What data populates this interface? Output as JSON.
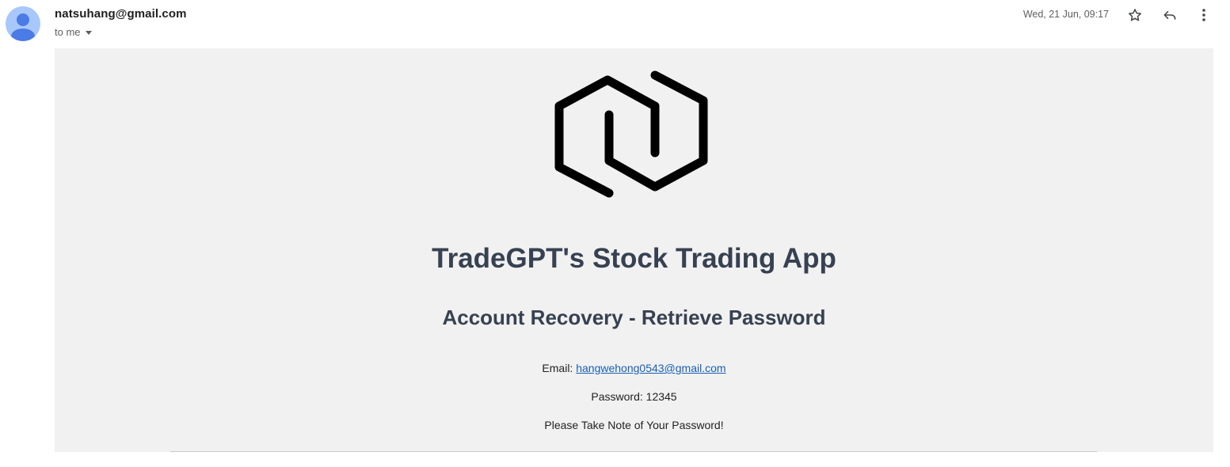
{
  "header": {
    "sender": "natsuhang@gmail.com",
    "recipient_label": "to me",
    "date": "Wed, 21 Jun, 09:17"
  },
  "icons": {
    "avatar": "person-icon",
    "recipient_toggle": "caret-down-icon",
    "star": "star-icon",
    "reply": "reply-icon",
    "more": "more-vert-icon",
    "logo": "hexagon-logo"
  },
  "body": {
    "title": "TradeGPT's Stock Trading App",
    "subtitle": "Account Recovery - Retrieve Password",
    "email_prefix": "Email:",
    "email_value": "hangwehong0543@gmail.com",
    "password_line": "Password: 12345",
    "note": "Please Take Note of Your Password!"
  },
  "colors": {
    "body_background": "#f1f1f1",
    "heading": "#374151",
    "link": "#1a5fb4",
    "avatar": "#a8c7fa"
  }
}
